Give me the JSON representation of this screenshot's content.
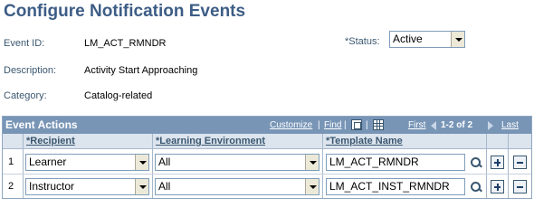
{
  "page": {
    "title": "Configure Notification Events"
  },
  "fields": {
    "event_id_label": "Event ID:",
    "event_id_value": "LM_ACT_RMNDR",
    "description_label": "Description:",
    "description_value": "Activity Start Approaching",
    "category_label": "Category:",
    "category_value": "Catalog-related",
    "status_label": "*Status:",
    "status_value": "Active"
  },
  "grid": {
    "title": "Event Actions",
    "nav": {
      "customize": "Customize",
      "separator": "|",
      "find": "Find",
      "first": "First",
      "range": "1-2 of 2",
      "last": "Last"
    },
    "columns": [
      "*Recipient",
      "*Learning Environment",
      "*Template Name"
    ],
    "rows": [
      {
        "num": "1",
        "recipient": "Learner",
        "environment": "All",
        "template": "LM_ACT_RMNDR"
      },
      {
        "num": "2",
        "recipient": "Instructor",
        "environment": "All",
        "template": "LM_ACT_INST_RMNDR"
      }
    ]
  },
  "icons": {
    "zoom": "zoom-grid-icon",
    "download": "download-grid-icon",
    "lookup": "lookup-icon",
    "add": "add-row-icon",
    "delete": "delete-row-icon"
  },
  "colors": {
    "title": "#3d5d86",
    "grid_header": "#7895b6",
    "column_header": "#dce4ee",
    "label": "#3a5770"
  }
}
